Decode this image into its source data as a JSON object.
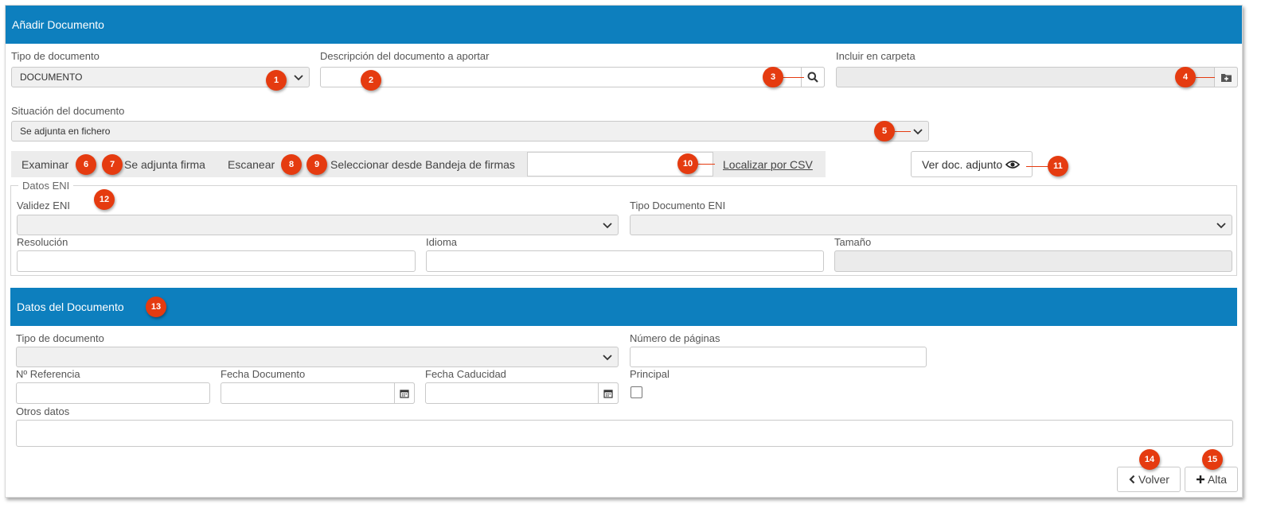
{
  "header": {
    "title": "Añadir Documento"
  },
  "row1": {
    "tipo_label": "Tipo de documento",
    "tipo_value": "DOCUMENTO",
    "descripcion_label": "Descripción del documento a aportar",
    "descripcion_value": "",
    "carpeta_label": "Incluir en carpeta",
    "carpeta_value": ""
  },
  "row2": {
    "situacion_label": "Situación del documento",
    "situacion_value": "Se adjunta en fichero"
  },
  "toolbar": {
    "examinar": "Examinar",
    "adjunta_firma": "Se adjunta firma",
    "escanear": "Escanear",
    "bandeja": "Seleccionar desde Bandeja de firmas",
    "csv_value": "",
    "localizar": "Localizar por CSV",
    "ver_doc": "Ver doc. adjunto"
  },
  "eni": {
    "legend": "Datos ENI",
    "validez_label": "Validez ENI",
    "validez_value": "",
    "tipo_label": "Tipo Documento ENI",
    "tipo_value": "",
    "resolucion_label": "Resolución",
    "resolucion_value": "",
    "idioma_label": "Idioma",
    "idioma_value": "",
    "tamano_label": "Tamaño",
    "tamano_value": ""
  },
  "datos": {
    "title": "Datos del Documento",
    "tipo_label": "Tipo de documento",
    "tipo_value": "",
    "paginas_label": "Número de páginas",
    "paginas_value": "",
    "referencia_label": "Nº Referencia",
    "referencia_value": "",
    "fecha_doc_label": "Fecha Documento",
    "fecha_doc_value": "",
    "fecha_cad_label": "Fecha Caducidad",
    "fecha_cad_value": "",
    "principal_label": "Principal",
    "principal_checked": false,
    "otros_label": "Otros datos",
    "otros_value": ""
  },
  "actions": {
    "volver": "Volver",
    "alta": "Alta"
  },
  "badges": [
    "1",
    "2",
    "3",
    "4",
    "5",
    "6",
    "7",
    "8",
    "9",
    "10",
    "11",
    "12",
    "13",
    "14",
    "15"
  ],
  "colors": {
    "header": "#0d7fbe",
    "badge": "#e53b10"
  },
  "icons": [
    "chevron-down-icon",
    "search-icon",
    "folder-plus-icon",
    "eye-icon",
    "calendar-icon",
    "chevron-left-icon",
    "plus-icon"
  ]
}
